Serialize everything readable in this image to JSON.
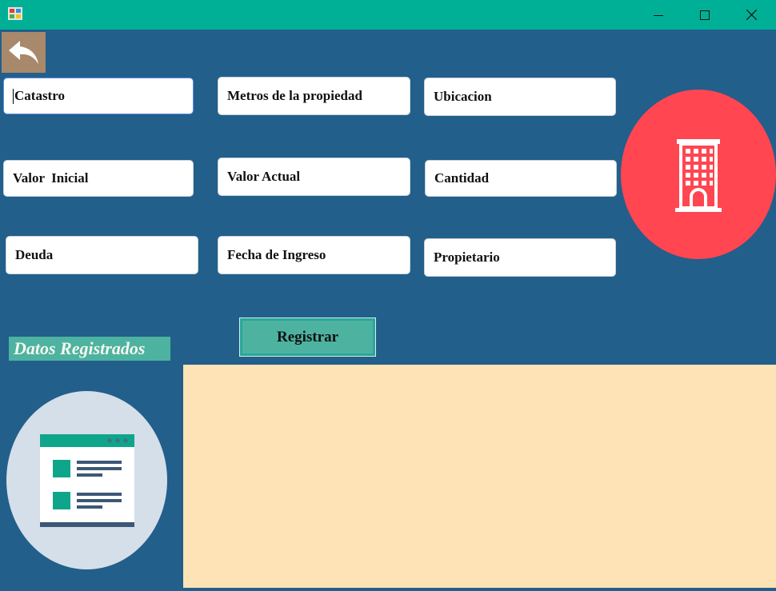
{
  "window": {
    "minimize_icon": "minimize-icon",
    "maximize_icon": "maximize-icon",
    "close_icon": "close-icon",
    "title_bar_color": "#00b096"
  },
  "toolbar": {
    "back_icon": "undo-arrow-icon"
  },
  "form": {
    "catastro": "Catastro",
    "metros": "Metros de la propiedad",
    "ubicacion": "Ubicacion",
    "valor_inicial": "Valor  Inicial",
    "valor_actual": "Valor Actual",
    "cantidad": "Cantidad",
    "deuda": "Deuda",
    "fecha_ingreso": "Fecha de Ingreso",
    "propietario": "Propietario"
  },
  "actions": {
    "register_label": "Registrar"
  },
  "section": {
    "registered_title": "Datos Registrados"
  },
  "icons": {
    "building": "building-icon",
    "document": "document-list-icon"
  },
  "colors": {
    "background": "#225f8b",
    "accent": "#4db3a0",
    "building_circle": "#ff4651",
    "panel": "#fde3b6"
  }
}
